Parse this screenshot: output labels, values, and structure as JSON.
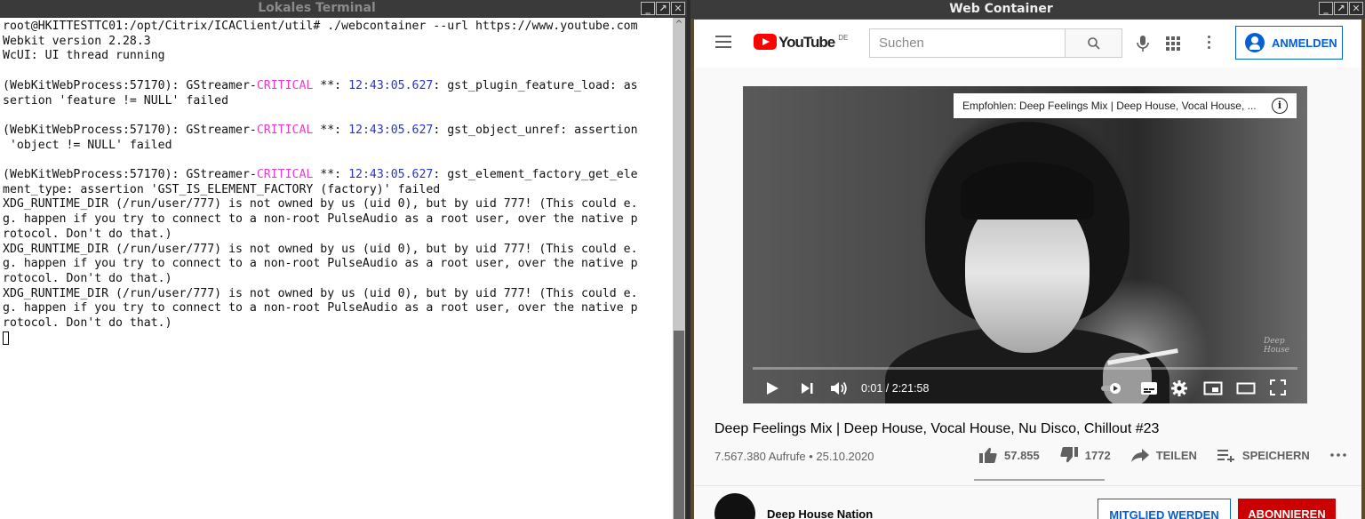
{
  "terminal": {
    "title": "Lokales Terminal",
    "lines": [
      {
        "text": "root@HKITTESTTC01:/opt/Citrix/ICAClient/util# ./webcontainer --url https://www.youtube.com"
      },
      {
        "text": "Webkit version 2.28.3"
      },
      {
        "text": "WcUI: UI thread running"
      },
      {
        "text": ""
      },
      {
        "pre": "(WebKitWebProcess:57170): GStreamer-",
        "crit": "CRITICAL",
        "mid": " **: ",
        "ts": "12:43:05.627",
        "post": ": gst_plugin_feature_load: as"
      },
      {
        "text": "sertion 'feature != NULL' failed"
      },
      {
        "text": ""
      },
      {
        "pre": "(WebKitWebProcess:57170): GStreamer-",
        "crit": "CRITICAL",
        "mid": " **: ",
        "ts": "12:43:05.627",
        "post": ": gst_object_unref: assertion"
      },
      {
        "text": " 'object != NULL' failed"
      },
      {
        "text": ""
      },
      {
        "pre": "(WebKitWebProcess:57170): GStreamer-",
        "crit": "CRITICAL",
        "mid": " **: ",
        "ts": "12:43:05.627",
        "post": ": gst_element_factory_get_ele"
      },
      {
        "text": "ment_type: assertion 'GST_IS_ELEMENT_FACTORY (factory)' failed"
      },
      {
        "text": "XDG_RUNTIME_DIR (/run/user/777) is not owned by us (uid 0), but by uid 777! (This could e."
      },
      {
        "text": "g. happen if you try to connect to a non-root PulseAudio as a root user, over the native p"
      },
      {
        "text": "rotocol. Don't do that.)"
      },
      {
        "text": "XDG_RUNTIME_DIR (/run/user/777) is not owned by us (uid 0), but by uid 777! (This could e."
      },
      {
        "text": "g. happen if you try to connect to a non-root PulseAudio as a root user, over the native p"
      },
      {
        "text": "rotocol. Don't do that.)"
      },
      {
        "text": "XDG_RUNTIME_DIR (/run/user/777) is not owned by us (uid 0), but by uid 777! (This could e."
      },
      {
        "text": "g. happen if you try to connect to a non-root PulseAudio as a root user, over the native p"
      },
      {
        "text": "rotocol. Don't do that.)"
      }
    ]
  },
  "web": {
    "title": "Web Container",
    "logo_text": "YouTube",
    "country_code": "DE",
    "search_placeholder": "Suchen",
    "signin_label": "ANMELDEN",
    "recommendation": "Empfohlen: Deep Feelings Mix | Deep House, Vocal House, ...",
    "watermark": "Deep House",
    "time_display": "0:01 / 2:21:58",
    "progress": 0.0,
    "video_title": "Deep Feelings Mix | Deep House, Vocal House, Nu Disco, Chillout #23",
    "views_date": "7.567.380 Aufrufe • 25.10.2020",
    "likes": "57.855",
    "dislikes": "1772",
    "share_label": "TEILEN",
    "save_label": "SPEICHERN",
    "channel_name": "Deep House Nation",
    "member_label": "MITGLIED WERDEN",
    "subscribe_label": "ABONNIEREN"
  },
  "window_buttons": [
    "_",
    "↗",
    "✕"
  ],
  "colors": {
    "critical": "#e53ecb",
    "timestamp": "#2a35c9",
    "yt_red": "#ff0000",
    "link_blue": "#065fd4",
    "subscribe_red": "#cc0000"
  }
}
